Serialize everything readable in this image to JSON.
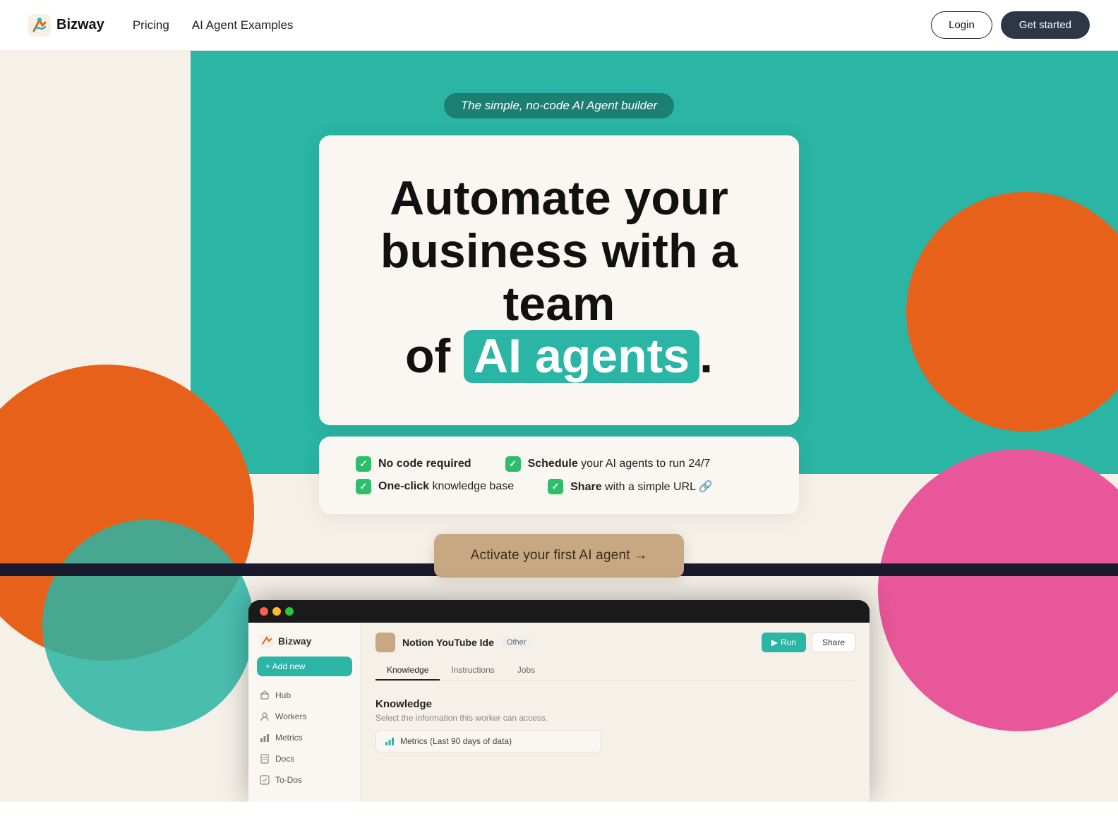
{
  "navbar": {
    "logo_text": "Bizway",
    "nav_links": [
      {
        "label": "Pricing",
        "id": "pricing"
      },
      {
        "label": "AI Agent Examples",
        "id": "ai-agent-examples"
      }
    ],
    "login_label": "Login",
    "getstarted_label": "Get started"
  },
  "hero": {
    "tagline": "The simple, no-code AI Agent builder",
    "headline_line1": "Automate your",
    "headline_line2": "business with a team",
    "headline_line3_pre": "of ",
    "headline_highlight": "AI agents",
    "headline_line3_post": ".",
    "features": [
      {
        "bold": "No code required",
        "rest": ""
      },
      {
        "bold": "Schedule",
        "rest": " your AI agents to run 24/7"
      },
      {
        "bold": "One-click",
        "rest": " knowledge base"
      },
      {
        "bold": "Share",
        "rest": " with a simple URL 🔗"
      }
    ],
    "cta_label": "Activate your first AI agent →"
  },
  "app_preview": {
    "sidebar": {
      "logo": "Bizway",
      "add_new": "+ Add new",
      "items": [
        {
          "label": "Hub",
          "icon": "home"
        },
        {
          "label": "Workers",
          "icon": "workers"
        },
        {
          "label": "Metrics",
          "icon": "metrics"
        },
        {
          "label": "Docs",
          "icon": "docs"
        },
        {
          "label": "To-Dos",
          "icon": "todos"
        }
      ]
    },
    "main": {
      "agent_name": "Notion YouTube Ide",
      "agent_tag": "Other",
      "btn_run": "Run",
      "btn_share": "Share",
      "tabs": [
        "Knowledge",
        "Instructions",
        "Jobs"
      ],
      "active_tab": "Knowledge",
      "knowledge_title": "Knowledge",
      "knowledge_sub": "Select the information this worker can access.",
      "knowledge_item": "Metrics  (Last 90 days of data)"
    }
  }
}
